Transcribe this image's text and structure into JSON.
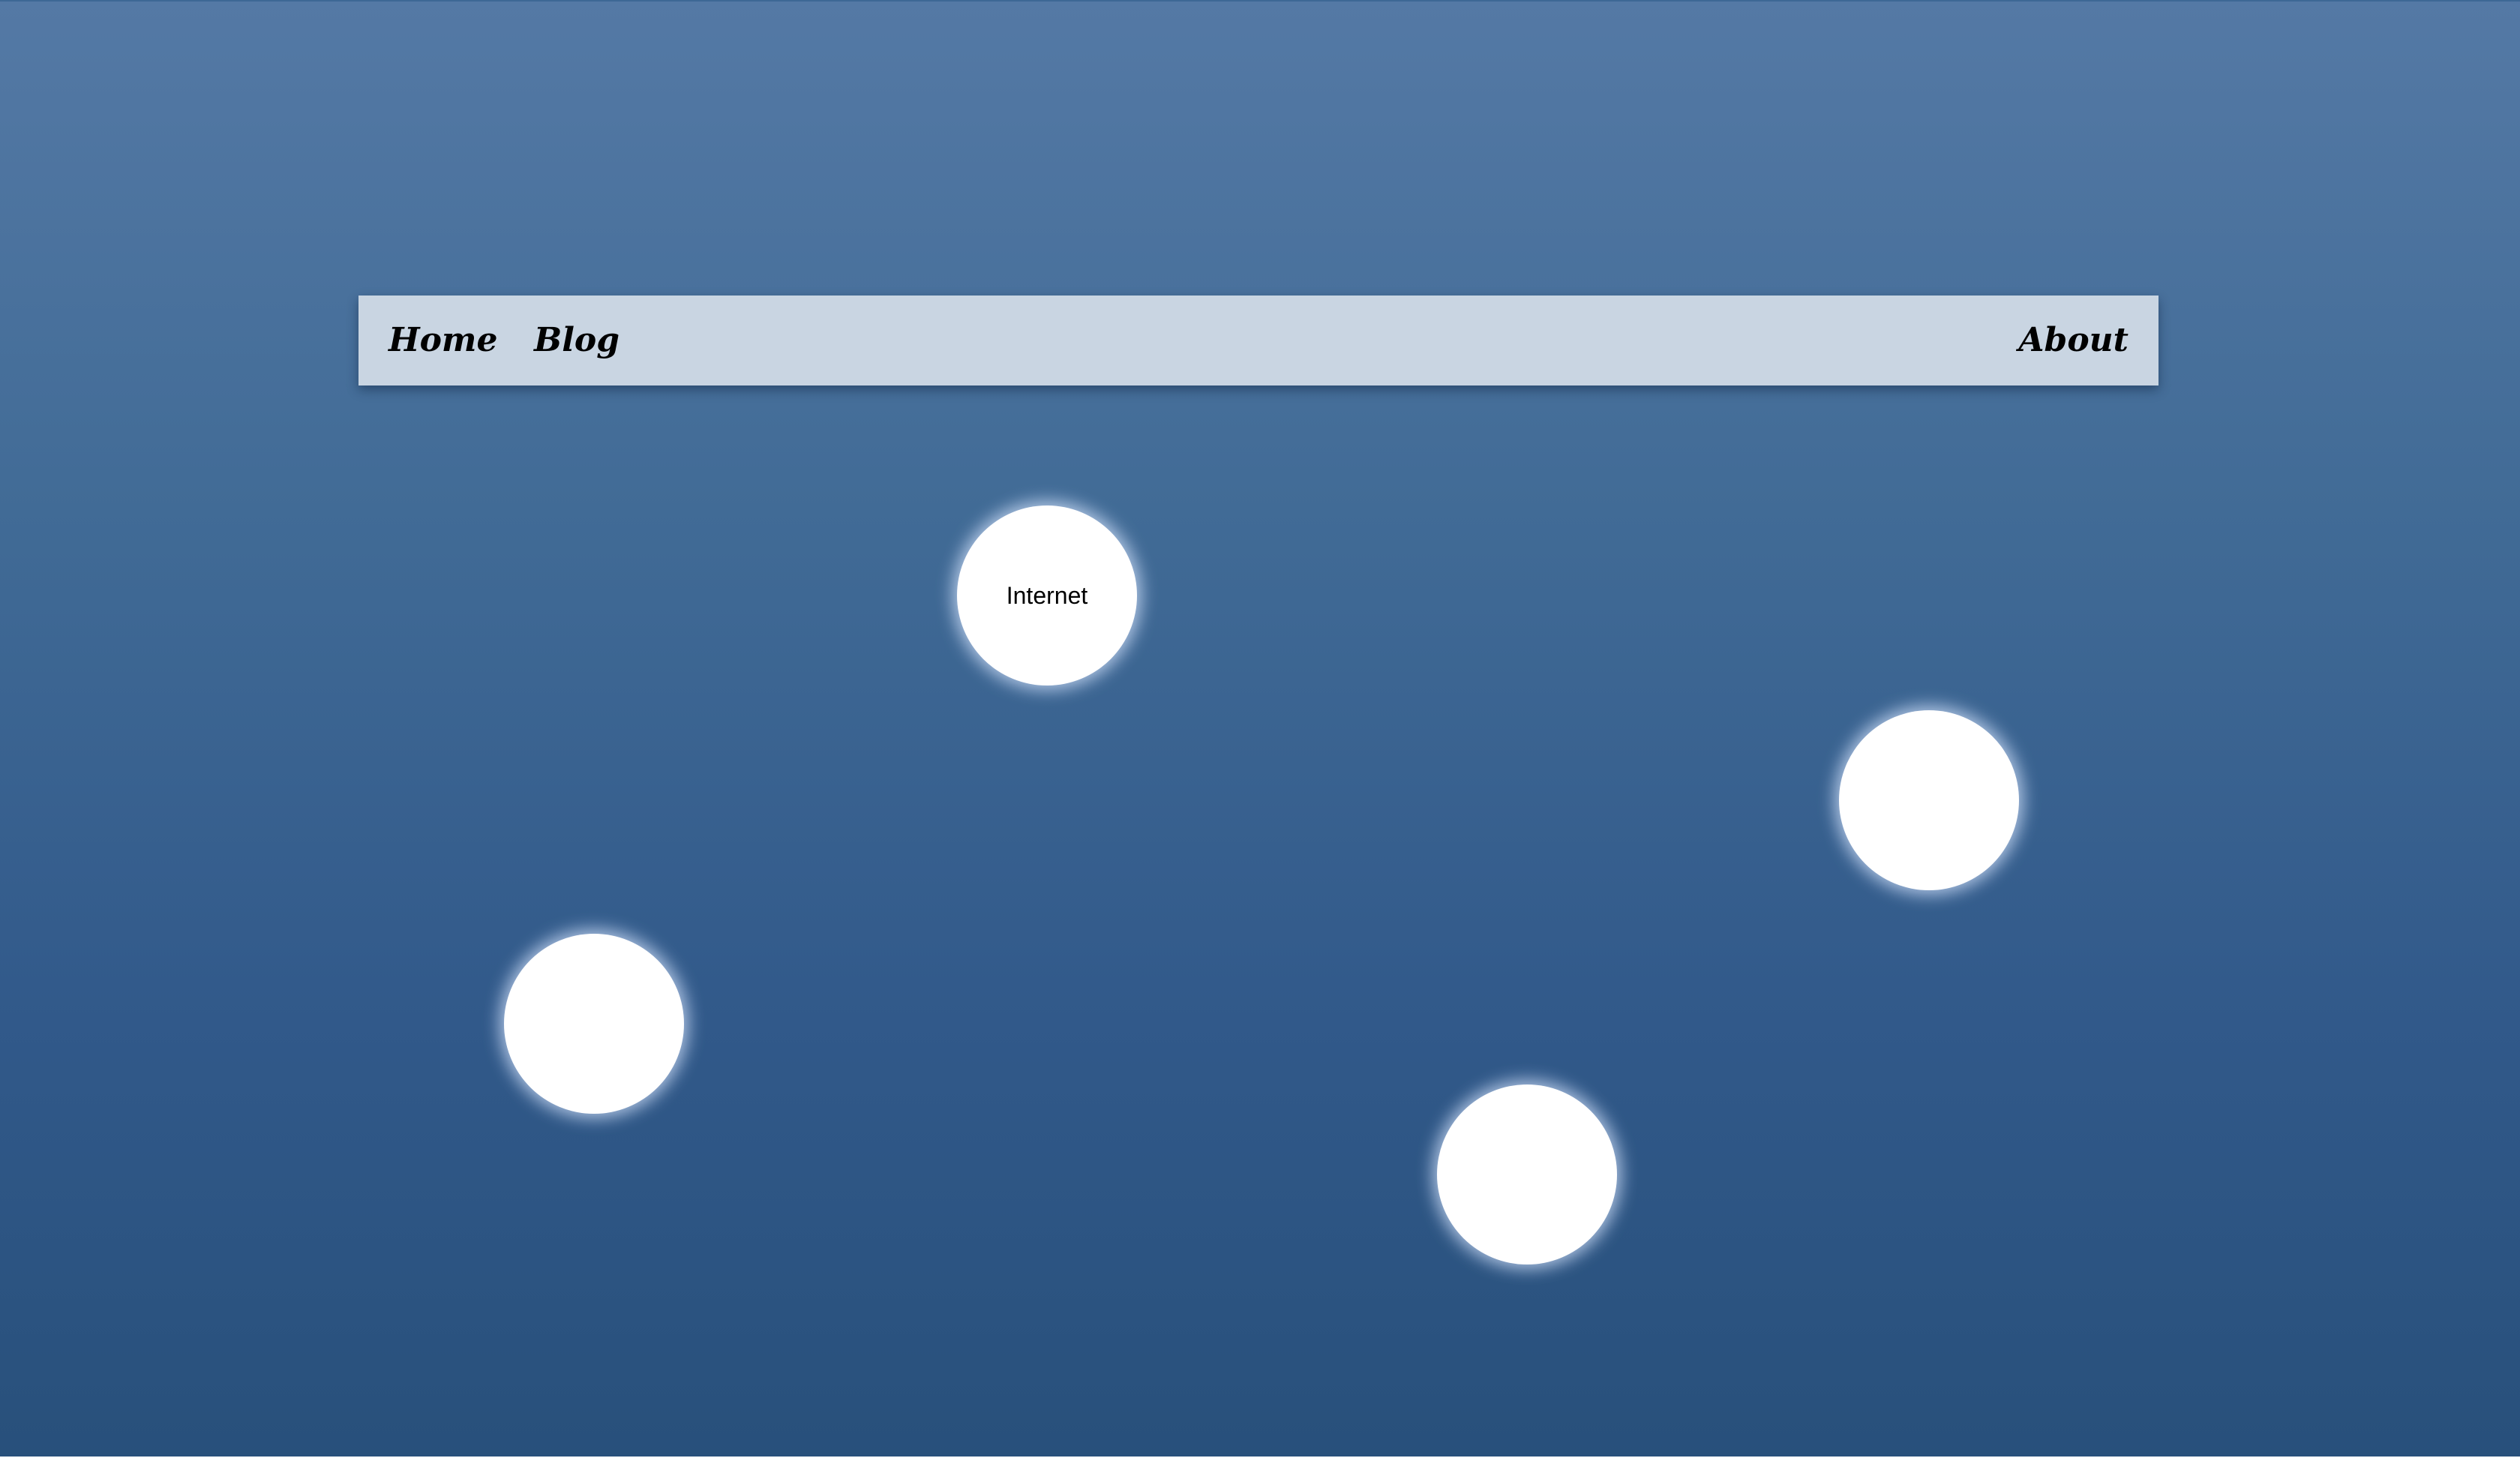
{
  "nav": {
    "home_label": "Home",
    "blog_label": "Blog",
    "about_label": "About"
  },
  "bubbles": [
    {
      "label": "Internet"
    },
    {
      "label": ""
    },
    {
      "label": ""
    },
    {
      "label": ""
    }
  ],
  "colors": {
    "background_top": "#5479a5",
    "background_bottom": "#28507b",
    "navbar": "#c9d5e2",
    "bubble": "#ffffff",
    "text": "#000000"
  }
}
